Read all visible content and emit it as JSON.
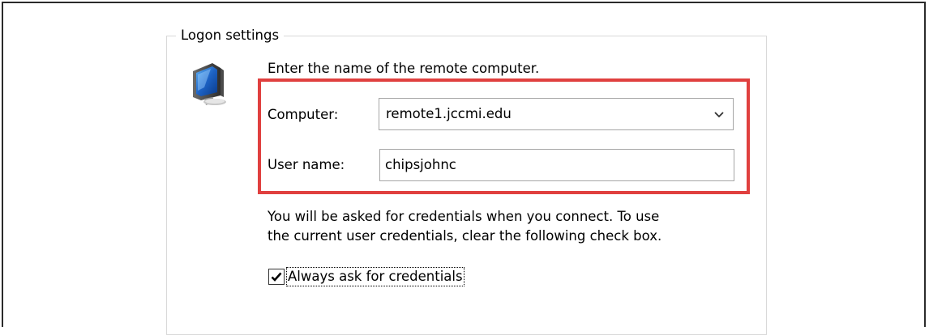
{
  "group": {
    "legend": "Logon settings"
  },
  "instruction": "Enter the name of the remote computer.",
  "computer": {
    "label": "Computer:",
    "value": "remote1.jccmi.edu"
  },
  "username": {
    "label": "User name:",
    "value": "chipsjohnc"
  },
  "info": {
    "line1": "You will be asked for credentials when you connect. To use",
    "line2": "the current user credentials, clear the following check box."
  },
  "always_ask": {
    "label": "Always ask for credentials",
    "checked": true
  },
  "icons": {
    "computer": "computer-monitor-icon",
    "dropdown": "chevron-down-icon",
    "check": "checkmark-icon"
  },
  "colors": {
    "highlight": "#e0403f",
    "monitor_blue": "#1d62c4"
  }
}
